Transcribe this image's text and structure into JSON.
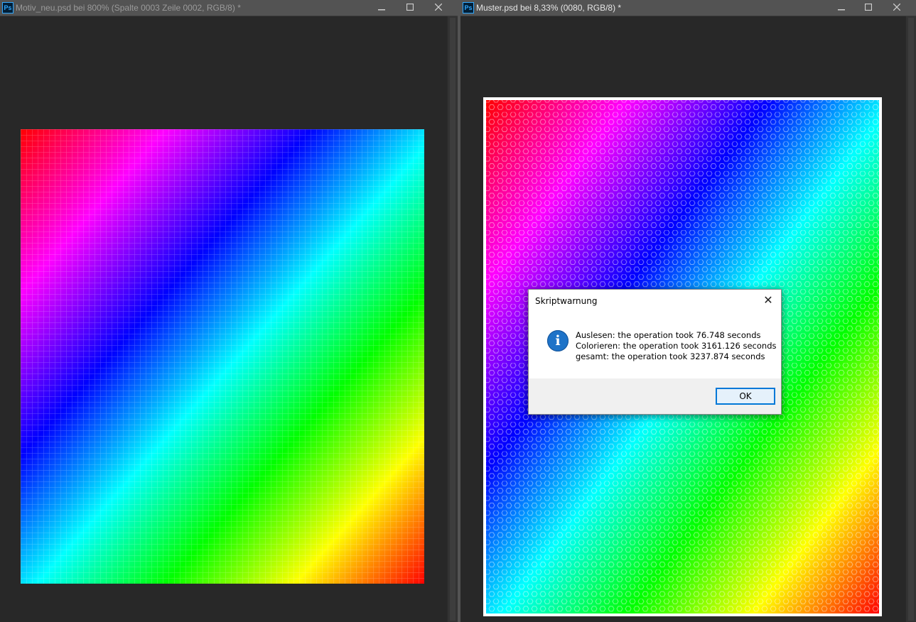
{
  "left_window": {
    "icon_label": "Ps",
    "title": "Motiv_neu.psd bei 800% (Spalte 0003 Zeile 0002, RGB/8) *"
  },
  "right_window": {
    "icon_label": "Ps",
    "title": "Muster.psd bei 8,33% (0080, RGB/8) *"
  },
  "window_controls": {
    "minimize": "minimize-icon",
    "maximize": "maximize-icon",
    "close": "close-icon"
  },
  "dialog": {
    "title": "Skriptwarnung",
    "close_symbol": "✕",
    "icon_symbol": "i",
    "messages": [
      "Auslesen: the operation took 76.748 seconds",
      "Colorieren: the operation took 3161.126 seconds",
      "gesamt: the operation took 3237.874 seconds"
    ],
    "ok_label": "OK"
  },
  "colors": {
    "workspace": "#282828",
    "titlebar": "#535353",
    "dialog_accent": "#0078d7",
    "gradient_stops": [
      "#ff0000",
      "#ff00ff",
      "#0000ff",
      "#00ffff",
      "#00ff00",
      "#ffff00",
      "#ff0000"
    ]
  }
}
